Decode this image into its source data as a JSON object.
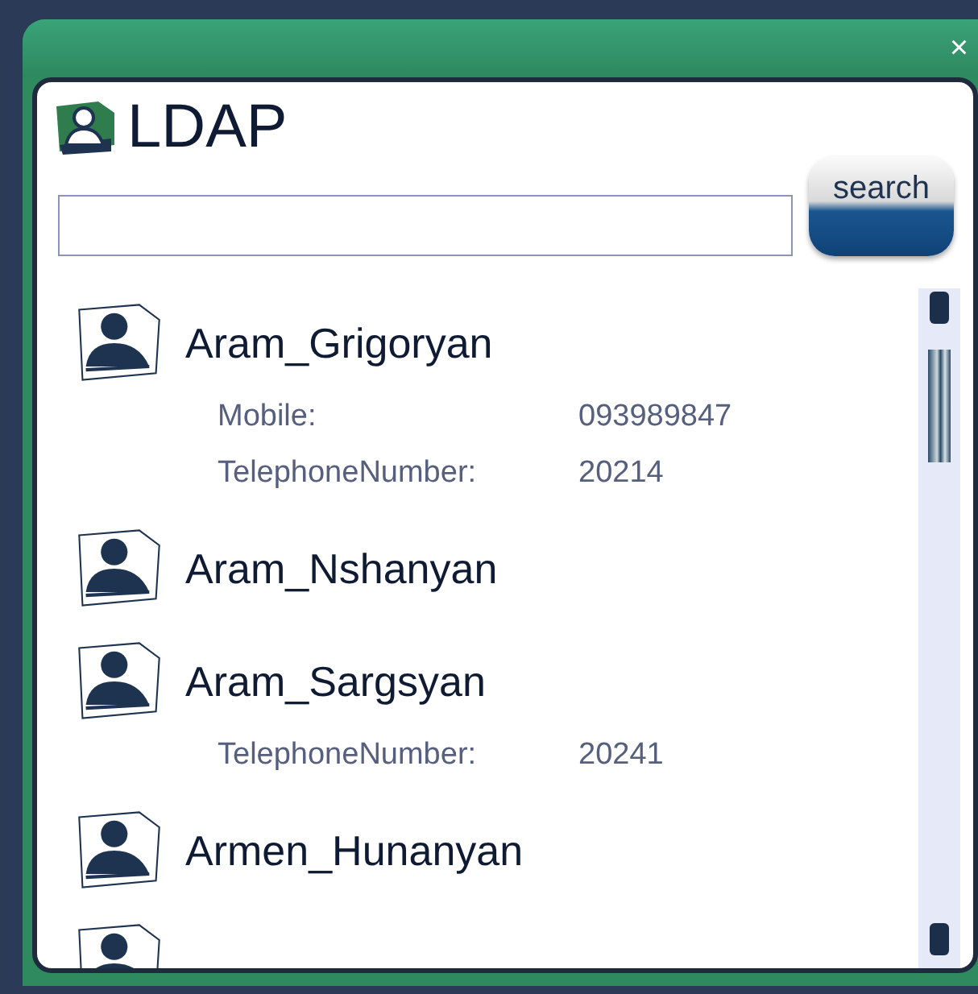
{
  "window": {
    "close": "×"
  },
  "header": {
    "title": "LDAP"
  },
  "search": {
    "button": "search"
  },
  "contacts": [
    {
      "name": "Aram_Grigoryan",
      "fields": [
        {
          "label": "Mobile:",
          "value": "093989847"
        },
        {
          "label": "TelephoneNumber:",
          "value": "20214"
        }
      ]
    },
    {
      "name": "Aram_Nshanyan"
    },
    {
      "name": "Aram_Sargsyan",
      "fields": [
        {
          "label": "TelephoneNumber:",
          "value": "20241"
        }
      ]
    },
    {
      "name": "Armen_Hunanyan"
    }
  ]
}
